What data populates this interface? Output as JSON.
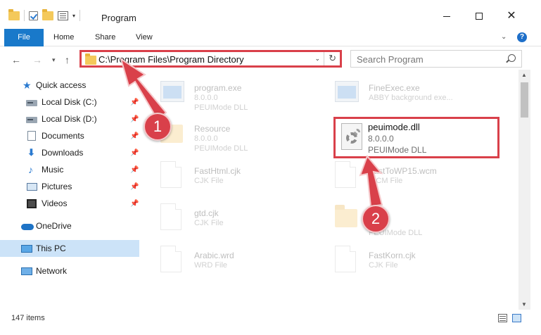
{
  "window": {
    "title": "Program",
    "minimize": "minimize",
    "maximize": "maximize",
    "close": "✕"
  },
  "ribbon": {
    "tabs": [
      "File",
      "Home",
      "Share",
      "View"
    ],
    "expand": "⌄",
    "help": "?"
  },
  "address": {
    "path": "C:\\Program Files\\Program Directory",
    "dropdown": "⌄",
    "refresh": "↻"
  },
  "search": {
    "placeholder": "Search Program"
  },
  "sidebar": {
    "items": [
      {
        "label": "Quick access",
        "icon": "star-icon",
        "pinned": false
      },
      {
        "label": "Local Disk (C:)",
        "icon": "drive-icon",
        "pinned": true
      },
      {
        "label": "Local Disk (D:)",
        "icon": "drive-icon",
        "pinned": true
      },
      {
        "label": "Documents",
        "icon": "documents-icon",
        "pinned": true
      },
      {
        "label": "Downloads",
        "icon": "download-icon",
        "pinned": true
      },
      {
        "label": "Music",
        "icon": "music-icon",
        "pinned": true
      },
      {
        "label": "Pictures",
        "icon": "pictures-icon",
        "pinned": true
      },
      {
        "label": "Videos",
        "icon": "videos-icon",
        "pinned": true
      },
      {
        "label": "OneDrive",
        "icon": "cloud-icon",
        "pinned": false
      },
      {
        "label": "This PC",
        "icon": "pc-icon",
        "pinned": false,
        "selected": true
      },
      {
        "label": "Network",
        "icon": "network-icon",
        "pinned": false
      }
    ]
  },
  "files": [
    {
      "name": "program.exe",
      "line1": "8.0.0.0",
      "line2": "PEUIMode DLL",
      "icon": "exe-icon"
    },
    {
      "name": "FineExec.exe",
      "line1": "ABBY background exe...",
      "line2": "",
      "icon": "exe-icon"
    },
    {
      "name": "Resource",
      "line1": "8.0.0.0",
      "line2": "PEUIMode DLL",
      "icon": "folder-icon"
    },
    {
      "name": "FastHtml.cjk",
      "line1": "CJK File",
      "line2": "",
      "icon": "document-icon"
    },
    {
      "name": "FastToWP15.wcm",
      "line1": "WCM File",
      "line2": "",
      "icon": "document-icon"
    },
    {
      "name": "gtd.cjk",
      "line1": "CJK File",
      "line2": "",
      "icon": "document-icon"
    },
    {
      "name": "",
      "line1": "PEUIMode DLL",
      "line2": "",
      "icon": "folder-icon"
    },
    {
      "name": "Arabic.wrd",
      "line1": "WRD File",
      "line2": "",
      "icon": "document-icon"
    },
    {
      "name": "FastKorn.cjk",
      "line1": "CJK File",
      "line2": "",
      "icon": "document-icon"
    }
  ],
  "highlighted_file": {
    "name": "peuimode.dll",
    "version": "8.0.0.0",
    "description": "PEUIMode DLL",
    "icon": "dll-gear-icon"
  },
  "status": {
    "count": "147 items"
  },
  "annotations": {
    "step1": "1",
    "step2": "2",
    "color": "#d9404a"
  }
}
